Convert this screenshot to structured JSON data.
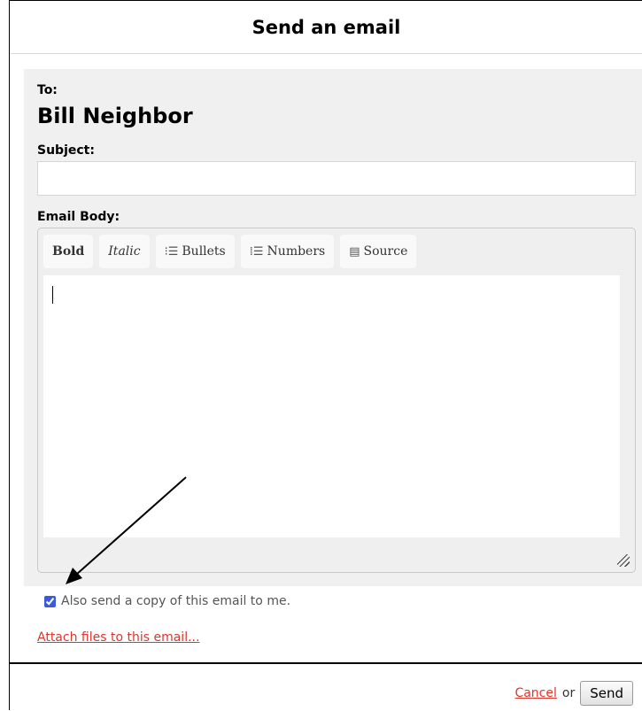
{
  "dialog": {
    "title": "Send an email"
  },
  "form": {
    "to_label": "To:",
    "to_name": "Bill Neighbor",
    "subject_label": "Subject:",
    "subject_value": "",
    "body_label": "Email Body:"
  },
  "toolbar": {
    "bold": "Bold",
    "italic": "Italic",
    "bullets": "Bullets",
    "numbers": "Numbers",
    "source": "Source",
    "bullets_icon": "⁝☰",
    "numbers_icon": "⁞☰",
    "source_icon": "▤"
  },
  "options": {
    "copy_label": "Also send a copy of this email to me.",
    "copy_checked": true
  },
  "links": {
    "attach": "Attach files to this email..."
  },
  "footer": {
    "cancel": "Cancel",
    "or": "or",
    "send": "Send"
  },
  "colors": {
    "link": "#e0352b",
    "panel": "#f0f0f0",
    "checkbox": "#3b5bdb"
  }
}
